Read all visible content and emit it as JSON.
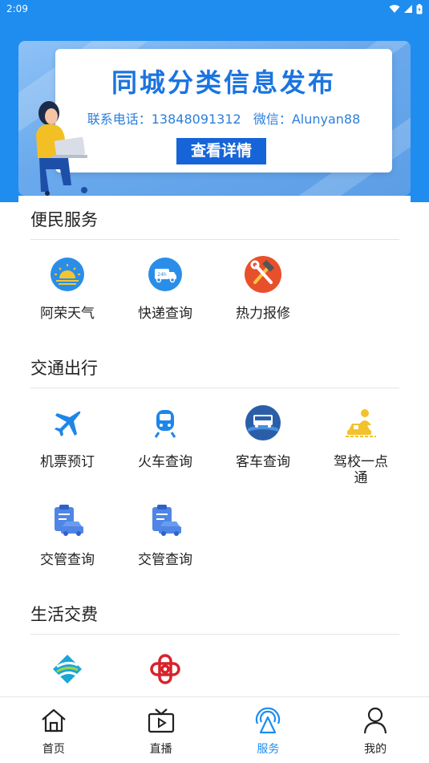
{
  "status_bar": {
    "time": "2:09"
  },
  "banner": {
    "title": "同城分类信息发布",
    "phone": "联系电话：13848091312",
    "wechat": "微信：Alunyan88",
    "button_label": "查看详情"
  },
  "sections": [
    {
      "title": "便民服务",
      "items": [
        {
          "label": "阿荣天气",
          "icon": "weather-icon"
        },
        {
          "label": "快递查询",
          "icon": "delivery-truck-icon"
        },
        {
          "label": "热力报修",
          "icon": "repair-tools-icon"
        }
      ]
    },
    {
      "title": "交通出行",
      "items": [
        {
          "label": "机票预订",
          "icon": "airplane-icon"
        },
        {
          "label": "火车查询",
          "icon": "train-icon"
        },
        {
          "label": "客车查询",
          "icon": "bus-icon"
        },
        {
          "label": "驾校一点通",
          "icon": "driving-school-icon"
        },
        {
          "label": "交管查询",
          "icon": "traffic-query-icon"
        },
        {
          "label": "交管查询",
          "icon": "traffic-query-icon"
        }
      ]
    },
    {
      "title": "生活交费",
      "items": [
        {
          "label": "",
          "icon": "china-mobile-icon"
        },
        {
          "label": "",
          "icon": "china-unicom-icon"
        }
      ]
    }
  ],
  "bottom_nav": [
    {
      "label": "首页",
      "icon": "home-icon"
    },
    {
      "label": "直播",
      "icon": "live-tv-icon"
    },
    {
      "label": "服务",
      "icon": "service-icon",
      "active": true
    },
    {
      "label": "我的",
      "icon": "user-icon"
    }
  ],
  "colors": {
    "primary": "#1f8cf0",
    "banner_title": "#1b74e0",
    "button": "#1565d8"
  }
}
